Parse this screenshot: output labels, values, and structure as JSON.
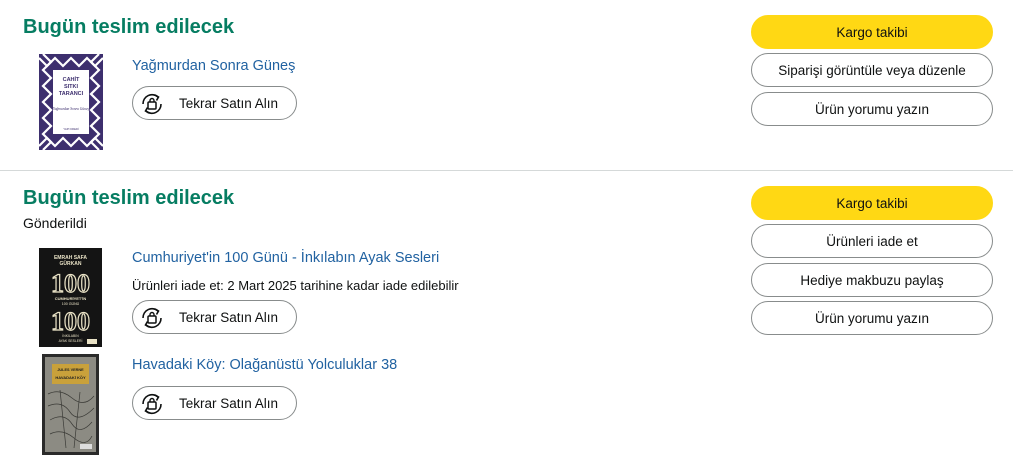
{
  "shipments": [
    {
      "status": "Bugün teslim edilecek",
      "products": [
        {
          "title": "Yağmurdan Sonra Güneş",
          "buy_again": "Tekrar Satın Alın"
        }
      ],
      "actions": [
        "Kargo takibi",
        "Siparişi görüntüle veya düzenle",
        "Ürün yorumu yazın"
      ]
    },
    {
      "status": "Bugün teslim edilecek",
      "substatus": "Gönderildi",
      "products": [
        {
          "title": "Cumhuriyet'in 100 Günü - İnkılabın Ayak Sesleri",
          "return_note": "Ürünleri iade et: 2 Mart 2025 tarihine kadar iade edilebilir",
          "buy_again": "Tekrar Satın Alın"
        },
        {
          "title": "Havadaki Köy: Olağanüstü Yolculuklar 38",
          "buy_again": "Tekrar Satın Alın"
        }
      ],
      "actions": [
        "Kargo takibi",
        "Ürünleri iade et",
        "Hediye makbuzu paylaş",
        "Ürün yorumu yazın"
      ]
    }
  ],
  "book_covers": [
    {
      "author_lines": [
        "CAHİT",
        "SITKI",
        "TARANCI"
      ],
      "subtitle": "Yağmurdan Sonra Güneş",
      "publisher": "YAPI KREDİ"
    },
    {
      "author_lines": [
        "EMRAH SAFA",
        "GÜRKAN"
      ],
      "big_number": "100",
      "mid_line": "CUMHURİYET'İN",
      "mid_line2": "100 GÜNÜ",
      "bottom_line": "İNKILABIN",
      "bottom_line2": "AYAK SESLERİ"
    },
    {
      "author": "JULES VERNE",
      "title": "HAVADAKİ KÖY"
    }
  ],
  "colors": {
    "status_green": "#067d62",
    "link_blue": "#2162a1",
    "primary_yellow": "#ffd814",
    "border_gray": "#888c8c"
  }
}
